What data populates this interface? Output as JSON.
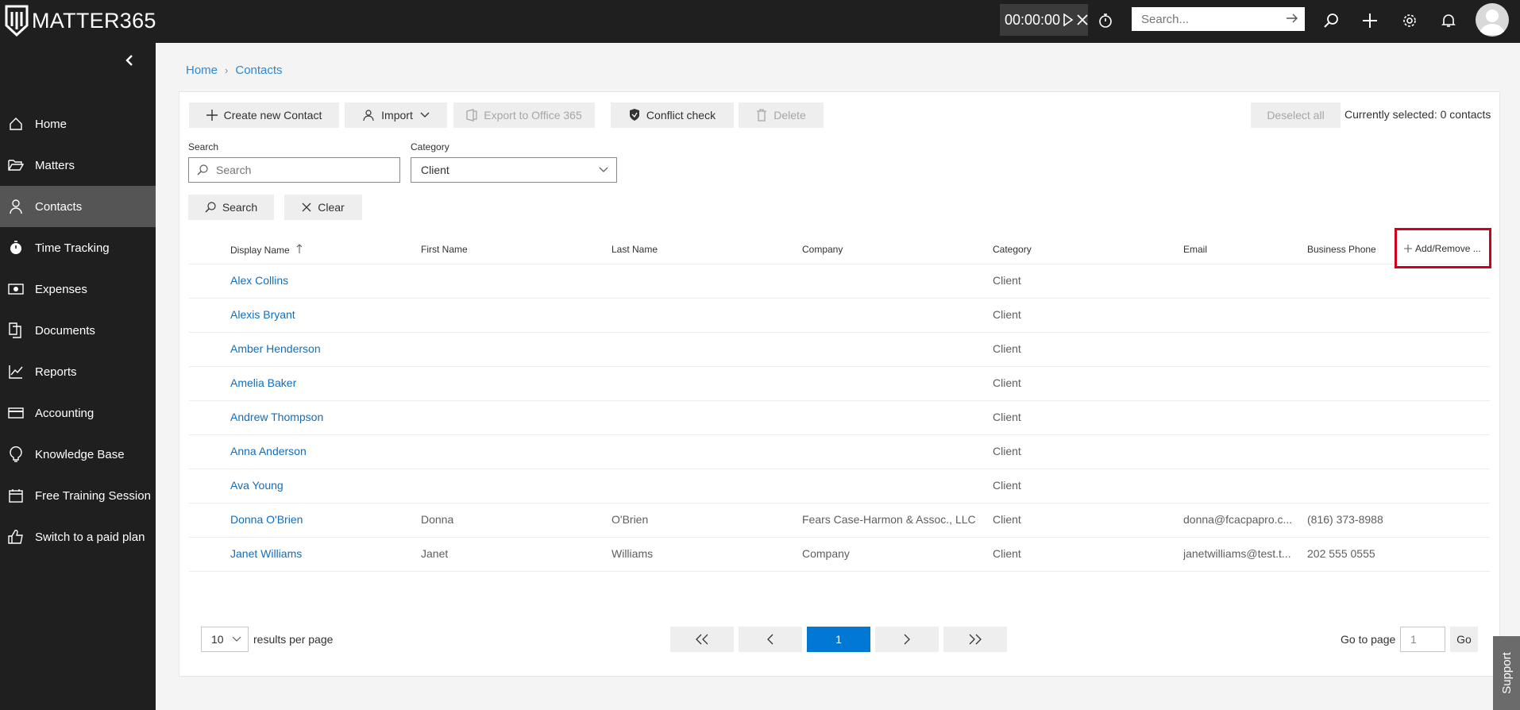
{
  "app": {
    "logo_text": "MATTER365"
  },
  "topbar": {
    "timer": "00:00:00",
    "search_placeholder": "Search..."
  },
  "sidebar": {
    "items": [
      {
        "label": "Home",
        "icon": "home-icon"
      },
      {
        "label": "Matters",
        "icon": "folder-icon"
      },
      {
        "label": "Contacts",
        "icon": "person-icon",
        "active": true
      },
      {
        "label": "Time Tracking",
        "icon": "stopwatch-icon"
      },
      {
        "label": "Expenses",
        "icon": "money-icon"
      },
      {
        "label": "Documents",
        "icon": "documents-icon"
      },
      {
        "label": "Reports",
        "icon": "chart-icon"
      },
      {
        "label": "Accounting",
        "icon": "card-icon"
      },
      {
        "label": "Knowledge Base",
        "icon": "lightbulb-icon"
      },
      {
        "label": "Free Training Session",
        "icon": "calendar-icon"
      },
      {
        "label": "Switch to a paid plan",
        "icon": "thumbs-up-icon"
      }
    ]
  },
  "breadcrumb": {
    "home": "Home",
    "current": "Contacts"
  },
  "toolbar": {
    "create": "Create new Contact",
    "import": "Import",
    "export": "Export to Office 365",
    "conflict": "Conflict check",
    "delete": "Delete",
    "deselect": "Deselect all",
    "selected_text": "Currently selected: 0 contacts"
  },
  "filters": {
    "search_label": "Search",
    "search_placeholder": "Search",
    "category_label": "Category",
    "category_value": "Client",
    "search_button": "Search",
    "clear_button": "Clear"
  },
  "table": {
    "headers": {
      "display_name": "Display Name",
      "first_name": "First Name",
      "last_name": "Last Name",
      "company": "Company",
      "category": "Category",
      "email": "Email",
      "business_phone": "Business Phone",
      "add_remove": "Add/Remove ..."
    },
    "rows": [
      {
        "display_name": "Alex Collins",
        "first_name": "",
        "last_name": "",
        "company": "",
        "category": "Client",
        "email": "",
        "phone": ""
      },
      {
        "display_name": "Alexis Bryant",
        "first_name": "",
        "last_name": "",
        "company": "",
        "category": "Client",
        "email": "",
        "phone": ""
      },
      {
        "display_name": "Amber Henderson",
        "first_name": "",
        "last_name": "",
        "company": "",
        "category": "Client",
        "email": "",
        "phone": ""
      },
      {
        "display_name": "Amelia Baker",
        "first_name": "",
        "last_name": "",
        "company": "",
        "category": "Client",
        "email": "",
        "phone": ""
      },
      {
        "display_name": "Andrew Thompson",
        "first_name": "",
        "last_name": "",
        "company": "",
        "category": "Client",
        "email": "",
        "phone": ""
      },
      {
        "display_name": "Anna Anderson",
        "first_name": "",
        "last_name": "",
        "company": "",
        "category": "Client",
        "email": "",
        "phone": ""
      },
      {
        "display_name": "Ava Young",
        "first_name": "",
        "last_name": "",
        "company": "",
        "category": "Client",
        "email": "",
        "phone": ""
      },
      {
        "display_name": "Donna O'Brien",
        "first_name": "Donna",
        "last_name": "O'Brien",
        "company": "Fears Case-Harmon & Assoc., LLC",
        "category": "Client",
        "email": "donna@fcacpapro.c...",
        "phone": "(816) 373-8988"
      },
      {
        "display_name": "Janet Williams",
        "first_name": "Janet",
        "last_name": "Williams",
        "company": "Company",
        "category": "Client",
        "email": "janetwilliams@test.t...",
        "phone": "202 555 0555"
      }
    ]
  },
  "pagination": {
    "per_page": "10",
    "per_page_label": "results per page",
    "current_page": "1",
    "goto_label": "Go to page",
    "goto_value": "1",
    "go_button": "Go"
  },
  "support": {
    "label": "Support"
  },
  "colors": {
    "accent": "#0078d4",
    "link": "#106ebe",
    "sidebar": "#1f1f1f",
    "highlight": "#d0021b"
  }
}
